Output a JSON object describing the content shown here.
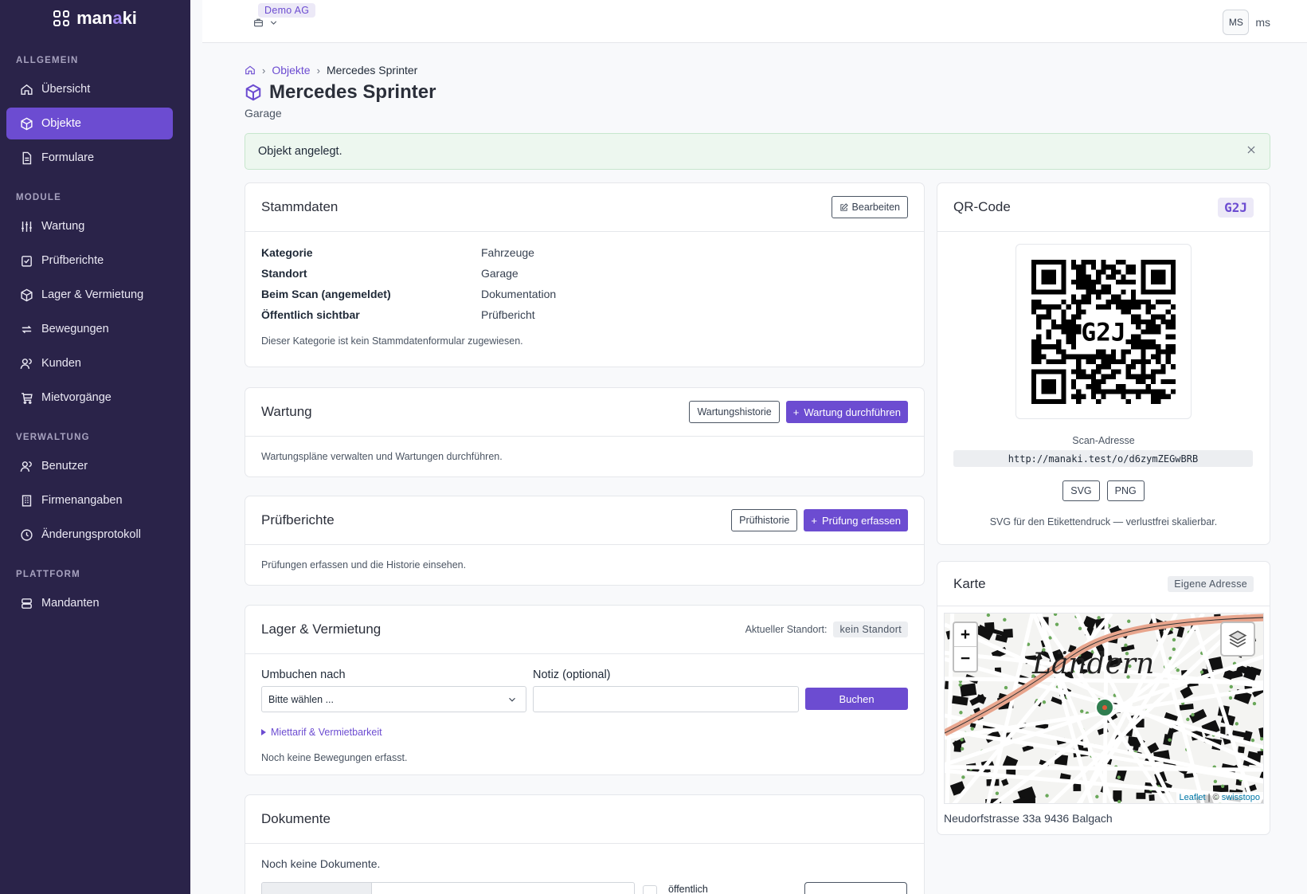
{
  "brand": {
    "name_left": "man",
    "name_accent": "a",
    "name_right": "ki"
  },
  "sidebar": {
    "sections": [
      {
        "label": "ALLGEMEIN",
        "items": [
          {
            "label": "Übersicht",
            "icon": "home-icon"
          },
          {
            "label": "Objekte",
            "icon": "box-icon",
            "active": true
          },
          {
            "label": "Formulare",
            "icon": "document-icon"
          }
        ]
      },
      {
        "label": "MODULE",
        "items": [
          {
            "label": "Wartung",
            "icon": "sliders-icon"
          },
          {
            "label": "Prüfberichte",
            "icon": "check-square-icon"
          },
          {
            "label": "Lager & Vermietung",
            "icon": "package-icon"
          },
          {
            "label": "Bewegungen",
            "icon": "repeat-icon"
          },
          {
            "label": "Kunden",
            "icon": "users-icon"
          },
          {
            "label": "Mietvorgänge",
            "icon": "cart-icon"
          }
        ]
      },
      {
        "label": "VERWALTUNG",
        "items": [
          {
            "label": "Benutzer",
            "icon": "users-icon"
          },
          {
            "label": "Firmenangaben",
            "icon": "building-icon"
          },
          {
            "label": "Änderungsprotokoll",
            "icon": "clock-icon"
          }
        ]
      },
      {
        "label": "PLATTFORM",
        "items": [
          {
            "label": "Mandanten",
            "icon": "server-icon"
          }
        ]
      }
    ]
  },
  "topbar": {
    "tenant": "Demo AG",
    "user_initials": "MS",
    "user_name": "ms"
  },
  "breadcrumb": {
    "link": "Objekte",
    "current": "Mercedes Sprinter"
  },
  "page": {
    "title": "Mercedes Sprinter",
    "subtitle": "Garage"
  },
  "alert": {
    "message": "Objekt angelegt."
  },
  "stammdaten": {
    "title": "Stammdaten",
    "edit_label": "Bearbeiten",
    "rows": [
      {
        "key": "Kategorie",
        "value": "Fahrzeuge"
      },
      {
        "key": "Standort",
        "value": "Garage"
      },
      {
        "key": "Beim Scan (angemeldet)",
        "value": "Dokumentation"
      },
      {
        "key": "Öffentlich sichtbar",
        "value": "Prüfbericht"
      }
    ],
    "note": "Dieser Kategorie ist kein Stammdatenformular zugewiesen."
  },
  "wartung": {
    "title": "Wartung",
    "history_label": "Wartungshistorie",
    "action_label": "Wartung durchführen",
    "body": "Wartungspläne verwalten und Wartungen durchführen."
  },
  "pruefberichte": {
    "title": "Prüfberichte",
    "history_label": "Prüfhistorie",
    "action_label": "Prüfung erfassen",
    "body": "Prüfungen erfassen und die Historie einsehen."
  },
  "lager": {
    "title": "Lager & Vermietung",
    "location_label": "Aktueller Standort:",
    "location_value": "kein Standort",
    "move_label": "Umbuchen nach",
    "move_placeholder": "Bitte wählen ...",
    "note_label": "Notiz (optional)",
    "note_value": "",
    "book_label": "Buchen",
    "details_label": "Miettarif & Vermietbarkeit",
    "empty": "Noch keine Bewegungen erfasst."
  },
  "dokumente": {
    "title": "Dokumente",
    "empty": "Noch keine Dokumente.",
    "public_label": "öffentlich"
  },
  "qr": {
    "title": "QR-Code",
    "code": "G2J",
    "scan_label": "Scan-Adresse",
    "scan_url": "http://manaki.test/o/d6zymZEGwBRB",
    "svg_label": "SVG",
    "png_label": "PNG",
    "note": "SVG für den Etikettendruck — verlustfrei skalierbar."
  },
  "karte": {
    "title": "Karte",
    "tag": "Eigene Adresse",
    "map_label": "Ländern",
    "attrib_leaflet": "Leaflet",
    "attrib_sep": " | © ",
    "attrib_source": "swisstopo",
    "address": "Neudorfstrasse 33a 9436 Balgach"
  },
  "colors": {
    "sidebar": "#2a2349",
    "accent": "#6c4cd1",
    "alert_bg": "#edf7ef"
  }
}
